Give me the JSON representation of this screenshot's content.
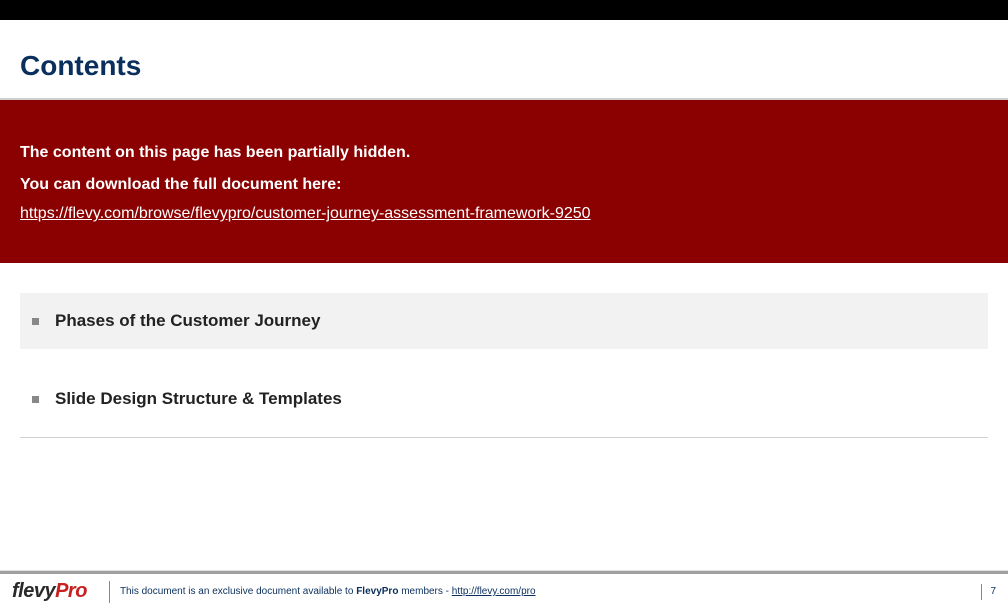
{
  "title": "Contents",
  "banner": {
    "line1": "The content on this page has been partially hidden.",
    "line2": "You can download the full document here:",
    "link_text": "https://flevy.com/browse/flevypro/customer-journey-assessment-framework-9250"
  },
  "items": [
    {
      "label": "Phases of the Customer Journey"
    },
    {
      "label": "Slide Design Structure & Templates"
    }
  ],
  "footer": {
    "logo_part1": "flevy",
    "logo_part2": "Pro",
    "text_prefix": "This document is an exclusive document available to ",
    "text_bold": "FlevyPro",
    "text_suffix": " members - ",
    "link_text": "http://flevy.com/pro",
    "page_number": "7"
  }
}
